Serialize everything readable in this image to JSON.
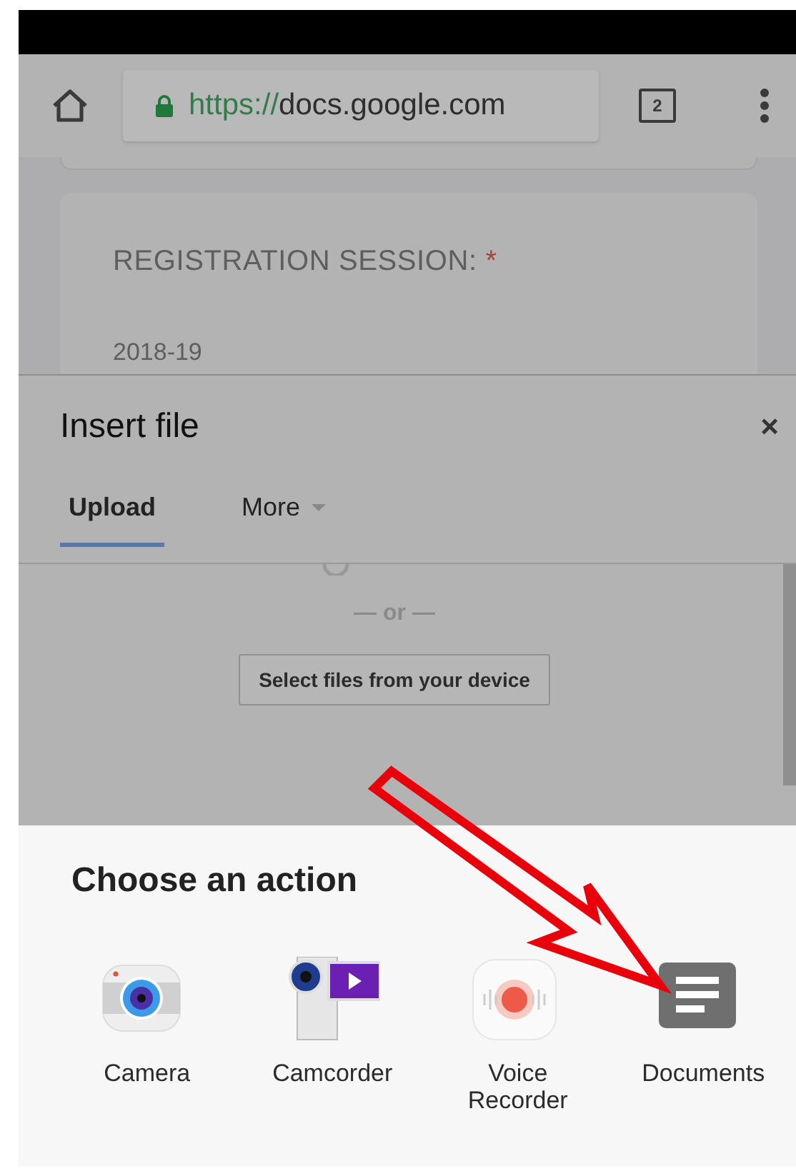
{
  "browser": {
    "url_scheme": "https://",
    "url_host": "docs.google.com",
    "tab_count": "2"
  },
  "form_card": {
    "question": "REGISTRATION SESSION:",
    "required_mark": "*",
    "answer": "2018-19"
  },
  "dialog": {
    "title": "Insert file",
    "close": "×",
    "tabs": [
      {
        "label": "Upload",
        "selected": true,
        "dropdown": false
      },
      {
        "label": "More",
        "selected": false,
        "dropdown": true
      }
    ],
    "separator": "— or —",
    "select_button": "Select files from your device"
  },
  "action_sheet": {
    "title": "Choose an action",
    "apps": [
      {
        "kind": "camera",
        "label": "Camera"
      },
      {
        "kind": "camcorder",
        "label": "Camcorder"
      },
      {
        "kind": "recorder",
        "label": "Voice Recorder"
      },
      {
        "kind": "documents",
        "label": "Documents"
      }
    ]
  }
}
